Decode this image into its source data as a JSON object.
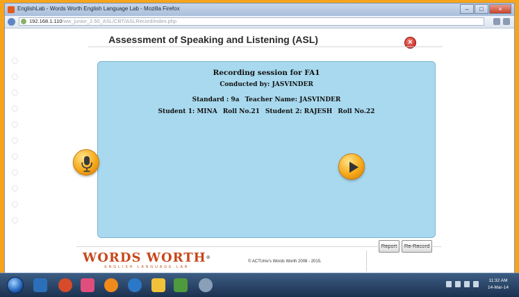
{
  "window": {
    "title": "EnglishLab - Words Worth English Language Lab - Mozilla Firefox",
    "url_host": "192.168.1.110",
    "url_path": "/ww_junior_2.50_ASL/CBT/ASLRecord/index.php"
  },
  "page": {
    "heading": "Assessment of Speaking and Listening (ASL)",
    "close_glyph": "×"
  },
  "session": {
    "title": "Recording session for FA1",
    "conducted_by": "Conducted by: JASVINDER",
    "standard": "Standard : 9a",
    "teacher": "Teacher Name: JASVINDER",
    "student1": "Student 1: MINA",
    "roll1": "Roll No.21",
    "student2": "Student 2: RAJESH",
    "roll2": "Roll No.22"
  },
  "buttons": {
    "report": "Report",
    "rerecord": "Re-Record"
  },
  "footer": {
    "logo": "WORDS WORTH",
    "logo_reg": "®",
    "logo_sub": "ENGLISH LANGUAGE LAB",
    "copyright": "© ACTUniv's Words Worth 2008 - 2015."
  },
  "taskbar": {
    "time": "11:32 AM",
    "date": "14-Mar-14"
  },
  "colors": {
    "panel": "#a8d9ee",
    "accent": "#f6a91a",
    "logo": "#c7471b",
    "taskbar": "#1c3150"
  }
}
